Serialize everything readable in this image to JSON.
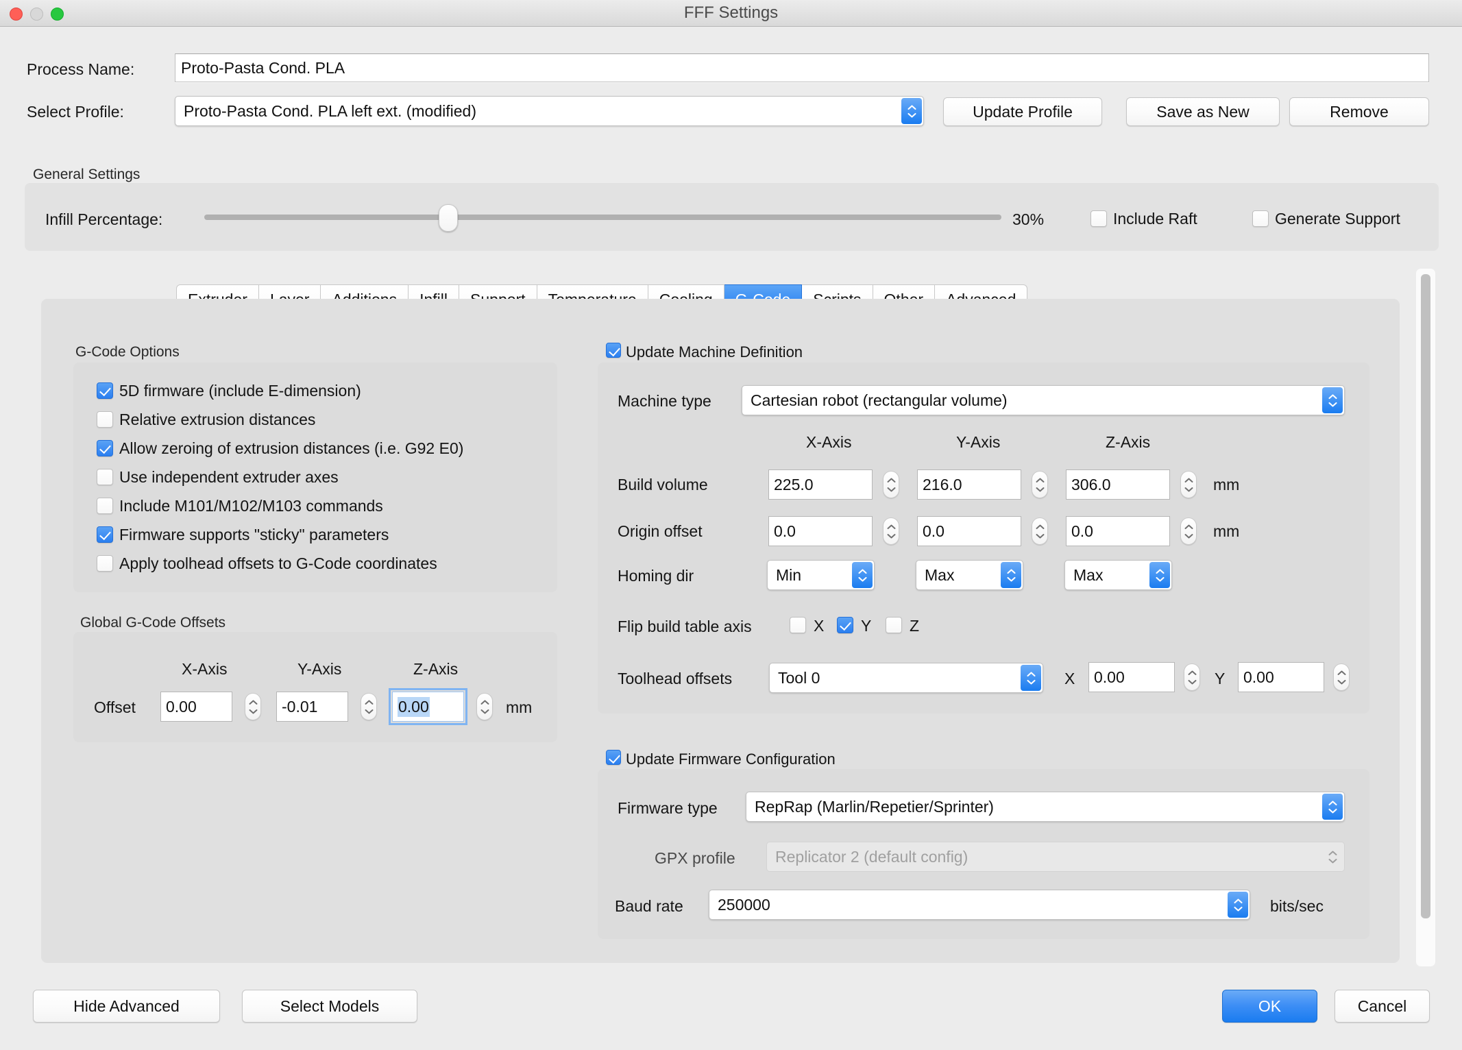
{
  "window": {
    "title": "FFF Settings",
    "traffic_lights": [
      "close",
      "minimize",
      "zoom"
    ]
  },
  "header": {
    "process_name_label": "Process Name:",
    "process_name_value": "Proto-Pasta Cond. PLA",
    "select_profile_label": "Select Profile:",
    "select_profile_value": "Proto-Pasta Cond. PLA left ext. (modified)",
    "update_profile_button": "Update Profile",
    "save_as_new_button": "Save as New",
    "remove_button": "Remove"
  },
  "general_settings": {
    "group_label": "General Settings",
    "infill_label": "Infill Percentage:",
    "infill_value": "30%",
    "infill_percent": 30,
    "include_raft": {
      "label": "Include Raft",
      "checked": false
    },
    "generate_support": {
      "label": "Generate Support",
      "checked": false
    }
  },
  "tabs": [
    {
      "label": "Extruder",
      "active": false
    },
    {
      "label": "Layer",
      "active": false
    },
    {
      "label": "Additions",
      "active": false
    },
    {
      "label": "Infill",
      "active": false
    },
    {
      "label": "Support",
      "active": false
    },
    {
      "label": "Temperature",
      "active": false
    },
    {
      "label": "Cooling",
      "active": false
    },
    {
      "label": "G-Code",
      "active": true
    },
    {
      "label": "Scripts",
      "active": false
    },
    {
      "label": "Other",
      "active": false
    },
    {
      "label": "Advanced",
      "active": false
    }
  ],
  "gcode_options": {
    "group_label": "G-Code Options",
    "items": [
      {
        "label": "5D firmware (include E-dimension)",
        "checked": true
      },
      {
        "label": "Relative extrusion distances",
        "checked": false
      },
      {
        "label": "Allow zeroing of extrusion distances (i.e. G92 E0)",
        "checked": true
      },
      {
        "label": "Use independent extruder axes",
        "checked": false
      },
      {
        "label": "Include M101/M102/M103 commands",
        "checked": false
      },
      {
        "label": "Firmware supports \"sticky\" parameters",
        "checked": true
      },
      {
        "label": "Apply toolhead offsets to G-Code coordinates",
        "checked": false
      }
    ]
  },
  "global_offsets": {
    "group_label": "Global G-Code Offsets",
    "axis_headers": [
      "X-Axis",
      "Y-Axis",
      "Z-Axis"
    ],
    "row_label": "Offset",
    "values": [
      "0.00",
      "-0.01",
      "0.00"
    ],
    "focused_index": 2,
    "unit": "mm"
  },
  "machine_definition": {
    "checkbox_label": "Update Machine Definition",
    "checkbox_checked": true,
    "machine_type_label": "Machine type",
    "machine_type_value": "Cartesian robot (rectangular volume)",
    "axis_headers": [
      "X-Axis",
      "Y-Axis",
      "Z-Axis"
    ],
    "build_volume_label": "Build volume",
    "build_volume_values": [
      "225.0",
      "216.0",
      "306.0"
    ],
    "build_volume_unit": "mm",
    "origin_offset_label": "Origin offset",
    "origin_offset_values": [
      "0.0",
      "0.0",
      "0.0"
    ],
    "origin_offset_unit": "mm",
    "homing_dir_label": "Homing dir",
    "homing_dir_values": [
      "Min",
      "Max",
      "Max"
    ],
    "flip_label": "Flip build table axis",
    "flip_axes": [
      {
        "label": "X",
        "checked": false
      },
      {
        "label": "Y",
        "checked": true
      },
      {
        "label": "Z",
        "checked": false
      }
    ],
    "toolhead_offsets_label": "Toolhead offsets",
    "toolhead_tool_value": "Tool 0",
    "toolhead_x_label": "X",
    "toolhead_x_value": "0.00",
    "toolhead_y_label": "Y",
    "toolhead_y_value": "0.00"
  },
  "firmware_config": {
    "checkbox_label": "Update Firmware Configuration",
    "checkbox_checked": true,
    "firmware_type_label": "Firmware type",
    "firmware_type_value": "RepRap (Marlin/Repetier/Sprinter)",
    "gpx_profile_label": "GPX profile",
    "gpx_profile_value": "Replicator 2 (default config)",
    "gpx_profile_disabled": true,
    "baud_rate_label": "Baud rate",
    "baud_rate_value": "250000",
    "baud_rate_unit": "bits/sec"
  },
  "footer": {
    "hide_advanced_button": "Hide Advanced",
    "select_models_button": "Select Models",
    "ok_button": "OK",
    "cancel_button": "Cancel"
  },
  "colors": {
    "accent": "#1f7bf0",
    "window_bg": "#ececec",
    "panel_bg": "#e0e0e0",
    "group_bg": "#dcdcdc"
  }
}
